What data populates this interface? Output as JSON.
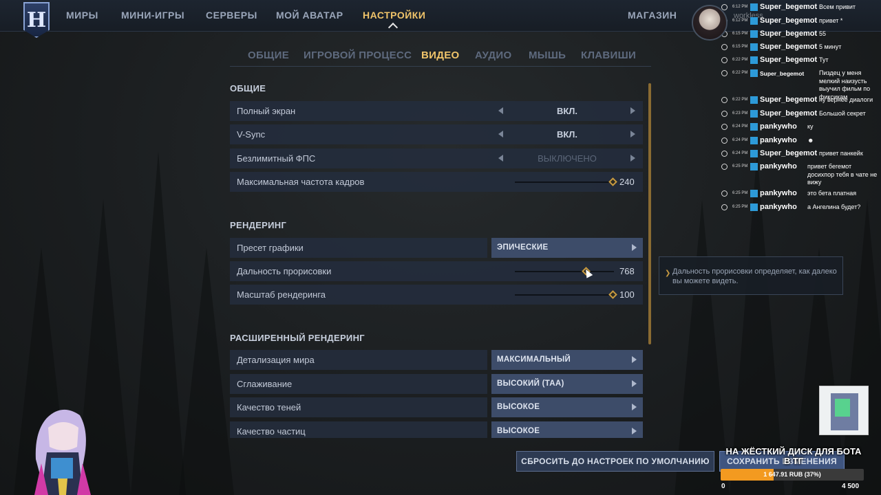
{
  "nav": {
    "logo": "H",
    "items": [
      "МИРЫ",
      "МИНИ-ИГРЫ",
      "СЕРВЕРЫ",
      "МОЙ АВАТАР",
      "НАСТРОЙКИ"
    ],
    "active": "НАСТРОЙКИ",
    "shop": "МАГАЗИН"
  },
  "tabs": {
    "items": [
      "ОБЩИЕ",
      "ИГРОВОЙ ПРОЦЕСС",
      "ВИДЕО",
      "АУДИО",
      "МЫШЬ",
      "КЛАВИШИ"
    ],
    "active": "ВИДЕО"
  },
  "sections": {
    "general": {
      "title": "ОБЩИЕ",
      "fullscreen": {
        "label": "Полный экран",
        "value": "ВКЛ."
      },
      "vsync": {
        "label": "V-Sync",
        "value": "ВКЛ."
      },
      "unlimited_fps": {
        "label": "Безлимитный ФПС",
        "value": "ВЫКЛЮЧЕНО"
      },
      "max_fps": {
        "label": "Максимальная частота кадров",
        "value": "240",
        "level": 1.0
      }
    },
    "rendering": {
      "title": "РЕНДЕРИНГ",
      "preset": {
        "label": "Пресет графики",
        "value": "ЭПИЧЕСКИЕ"
      },
      "view_distance": {
        "label": "Дальность прорисовки",
        "value": "768",
        "level": 0.72
      },
      "render_scale": {
        "label": "Масштаб рендеринга",
        "value": "100",
        "level": 1.0
      }
    },
    "advanced": {
      "title": "РАСШИРЕННЫЙ РЕНДЕРИНГ",
      "world_detail": {
        "label": "Детализация мира",
        "value": "МАКСИМАЛЬНЫЙ"
      },
      "antialiasing": {
        "label": "Сглаживание",
        "value": "ВЫСОКИЙ (TAA)"
      },
      "shadow_quality": {
        "label": "Качество теней",
        "value": "ВЫСОКОЕ"
      },
      "particle_quality": {
        "label": "Качество частиц",
        "value": "ВЫСОКОЕ"
      }
    }
  },
  "tooltip": {
    "text": "Дальность прорисовки определяет, как далеко вы можете видеть."
  },
  "buttons": {
    "reset": "СБРОСИТЬ ДО НАСТРОЕК ПО УМОЛЧАНИЮ",
    "save": "СОХРАНИТЬ ИЗМЕНЕНИЯ"
  },
  "chat": {
    "watermark": "workless",
    "messages": [
      {
        "time": "6:12 PM",
        "user": "Super_begemot",
        "text": "Всем привит"
      },
      {
        "time": "6:12 PM",
        "user": "Super_begemot",
        "text": "привет *"
      },
      {
        "time": "6:15 PM",
        "user": "Super_begemot",
        "text": "55"
      },
      {
        "time": "6:15 PM",
        "user": "Super_begemot",
        "text": "5 минут"
      },
      {
        "time": "6:22 PM",
        "user": "Super_begemot",
        "text": "Тут"
      },
      {
        "time": "6:22 PM",
        "user": "Super_begemot",
        "text": "Пиздец у меня мелкий наизусть выучил фильм по фиксикам"
      },
      {
        "time": "6:22 PM",
        "user": "Super_begemot",
        "text": "ну вернее диалоги"
      },
      {
        "time": "6:23 PM",
        "user": "Super_begemot",
        "text": "Большой секрет"
      },
      {
        "time": "6:24 PM",
        "user": "pankywho",
        "text": "ку"
      },
      {
        "time": "6:24 PM",
        "user": "pankywho",
        "text": "☻"
      },
      {
        "time": "6:24 PM",
        "user": "Super_begemot",
        "text": "привет панкейк"
      },
      {
        "time": "6:25 PM",
        "user": "pankywho",
        "text": "привет бегемот досихпор тебя в чате не вижу"
      },
      {
        "time": "6:25 PM",
        "user": "pankywho",
        "text": "это бета платная"
      },
      {
        "time": "6:25 PM",
        "user": "pankywho",
        "text": "а Ангелина будет?"
      }
    ]
  },
  "goal": {
    "title": "НА ЖЁСТКИЙ ДИСК ДЛЯ БОТА В ТГ",
    "progress_text": "1 647.91 RUB (37%)",
    "progress": 0.37,
    "min": "0",
    "max": "4 500",
    "fill_color": "#f39a20"
  }
}
